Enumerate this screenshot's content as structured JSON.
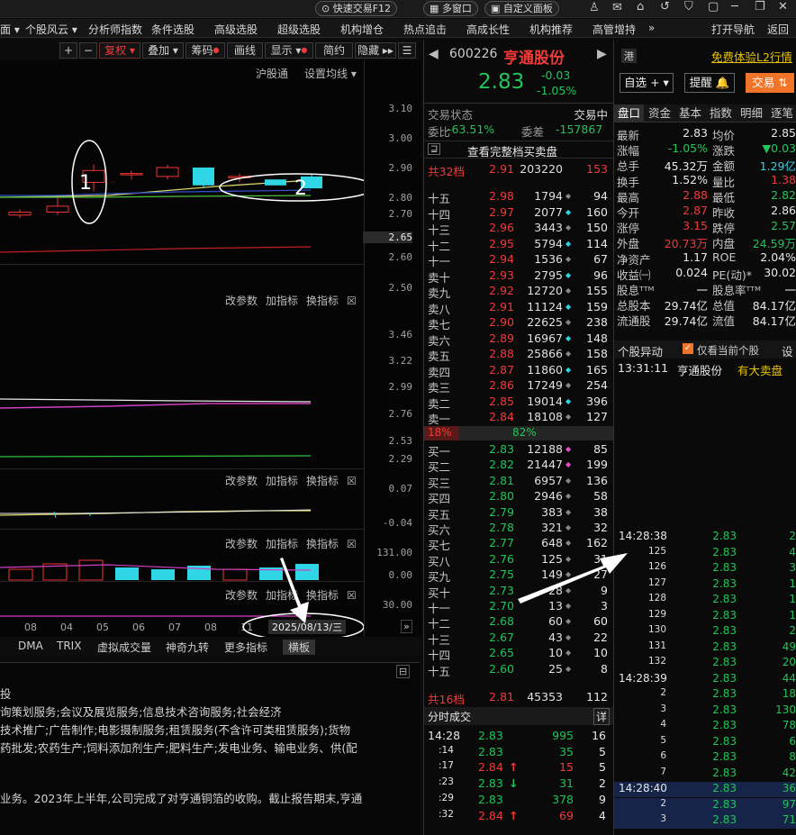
{
  "topbar": {
    "quick_trade": "快速交易F12",
    "multi_window": "多窗口",
    "custom_panel": "自定义面板"
  },
  "menu": [
    "面 ▾",
    "个股风云 ▾",
    "分析师指数",
    "条件选股",
    "高级选股",
    "超级选股",
    "机构增仓",
    "热点追击",
    "高成长性",
    "机构推荐",
    "高管增持",
    "»",
    "打开导航",
    "返回"
  ],
  "chart_toolbar": {
    "plus": "+",
    "minus": "−",
    "fuquan": "复权 ▾",
    "diejia": "叠加 ▾",
    "chouma": "筹码",
    "huaxian": "画线",
    "xianshi": "显示 ▾",
    "jianyue": "简约",
    "yincang": "隐藏 ▸▸"
  },
  "chart": {
    "hgt": "沪股通",
    "ma_setting": "设置均线 ▾",
    "price_axis": [
      "3.10",
      "3.00",
      "2.90",
      "2.80",
      "2.70",
      "2.65",
      "2.60",
      "2.50"
    ],
    "ind1_axis": [
      "3.46",
      "3.22",
      "2.99",
      "2.76",
      "2.53",
      "2.29"
    ],
    "ind2_axis": [
      "0.07",
      "-0.04"
    ],
    "ind3_axis": [
      "131.00",
      "0.00"
    ],
    "ind4_axis": [
      "30.00"
    ],
    "panel_actions": [
      "改参数",
      "加指标",
      "换指标",
      "☒"
    ],
    "x_labels": [
      "08",
      "04",
      "05",
      "06",
      "07",
      "08",
      "11"
    ],
    "date_label": "2025/08/13/三",
    "annotations": [
      "1",
      "2"
    ]
  },
  "chart_data": {
    "type": "candlestick",
    "x": [
      "08",
      "04",
      "05",
      "06",
      "07",
      "08",
      "11",
      "2025/08/13"
    ],
    "ohlc": [
      [
        2.74,
        2.76,
        2.73,
        2.75
      ],
      [
        2.75,
        2.8,
        2.74,
        2.77
      ],
      [
        2.85,
        2.91,
        2.82,
        2.89
      ],
      [
        2.88,
        2.89,
        2.86,
        2.88
      ],
      [
        2.87,
        2.91,
        2.86,
        2.9
      ],
      [
        2.9,
        2.9,
        2.83,
        2.84
      ],
      [
        2.87,
        2.88,
        2.85,
        2.87
      ],
      [
        2.86,
        2.86,
        2.84,
        2.84
      ],
      [
        2.87,
        2.88,
        2.83,
        2.83
      ]
    ]
  },
  "bottom_tabs": [
    "DMA",
    "TRIX",
    "虚拟成交量",
    "神奇九转",
    "更多指标",
    "横板"
  ],
  "info": {
    "title": "投",
    "lines": [
      "询策划服务;会议及展览服务;信息技术咨询服务;社会经济",
      "技术推广;广告制作;电影摄制服务;租赁服务(不含许可类租赁服务);货物",
      "药批发;农药生产;饲料添加剂生产;肥料生产;发电业务、输电业务、供(配",
      "业务。2023年上半年,公司完成了对亨通铜箔的收购。截止报告期末,亨通"
    ]
  },
  "quote": {
    "code": "600226",
    "name": "亨通股份",
    "price": "2.83",
    "change": "-0.03",
    "pct": "-1.05%",
    "status_label": "交易状态",
    "status": "交易中",
    "weibi_label": "委比",
    "weibi": "-63.51%",
    "weicha_label": "委差",
    "weicha": "-157867",
    "full_book": "查看完整档买卖盘",
    "ask_total_label": "共32档",
    "ask_total_price": "2.91",
    "ask_total_vol": "203220",
    "ask_total_n": "153",
    "ratio_left": "18%",
    "ratio_right": "82%",
    "bid_total_label": "共16档",
    "bid_total_price": "2.81",
    "bid_total_vol": "45353",
    "bid_total_n": "112"
  },
  "asks": [
    [
      "十五",
      "2.98",
      "1794",
      "94"
    ],
    [
      "十四",
      "2.97",
      "2077",
      "160"
    ],
    [
      "十三",
      "2.96",
      "3443",
      "150"
    ],
    [
      "十二",
      "2.95",
      "5794",
      "114"
    ],
    [
      "十一",
      "2.94",
      "1536",
      "67"
    ],
    [
      "卖十",
      "2.93",
      "2795",
      "96"
    ],
    [
      "卖九",
      "2.92",
      "12720",
      "155"
    ],
    [
      "卖八",
      "2.91",
      "11124",
      "159"
    ],
    [
      "卖七",
      "2.90",
      "22625",
      "238"
    ],
    [
      "卖六",
      "2.89",
      "16967",
      "148"
    ],
    [
      "卖五",
      "2.88",
      "25866",
      "158"
    ],
    [
      "卖四",
      "2.87",
      "11860",
      "165"
    ],
    [
      "卖三",
      "2.86",
      "17249",
      "254"
    ],
    [
      "卖二",
      "2.85",
      "19014",
      "396"
    ],
    [
      "卖一",
      "2.84",
      "18108",
      "127"
    ]
  ],
  "bids": [
    [
      "买一",
      "2.83",
      "12188",
      "85"
    ],
    [
      "买二",
      "2.82",
      "21447",
      "199"
    ],
    [
      "买三",
      "2.81",
      "6957",
      "136"
    ],
    [
      "买四",
      "2.80",
      "2946",
      "58"
    ],
    [
      "买五",
      "2.79",
      "383",
      "38"
    ],
    [
      "买六",
      "2.78",
      "321",
      "32"
    ],
    [
      "买七",
      "2.77",
      "648",
      "162"
    ],
    [
      "买八",
      "2.76",
      "125",
      "31"
    ],
    [
      "买九",
      "2.75",
      "149",
      "27"
    ],
    [
      "买十",
      "2.73",
      "28",
      "9"
    ],
    [
      "十一",
      "2.70",
      "13",
      "3"
    ],
    [
      "十二",
      "2.68",
      "60",
      "60"
    ],
    [
      "十三",
      "2.67",
      "43",
      "22"
    ],
    [
      "十四",
      "2.65",
      "10",
      "10"
    ],
    [
      "十五",
      "2.60",
      "25",
      "8"
    ]
  ],
  "fenshi": {
    "title": "分时成交",
    "detail": "详",
    "rows": [
      [
        "14:28",
        "2.83",
        "995",
        "16",
        ""
      ],
      [
        ":14",
        "2.83",
        "35",
        "5",
        ""
      ],
      [
        ":17",
        "2.84",
        "15",
        "5",
        "up"
      ],
      [
        ":23",
        "2.83",
        "31",
        "2",
        "down"
      ],
      [
        ":29",
        "2.83",
        "378",
        "9",
        ""
      ],
      [
        ":32",
        "2.84",
        "69",
        "4",
        "up"
      ]
    ]
  },
  "right": {
    "hk": "港",
    "free_l2": "免费体验L2行情",
    "zixuan": "自选 + ▾",
    "tixing": "提醒 🔔",
    "jiaoyi": "交易 ⇅",
    "tabs": [
      "盘口",
      "资金",
      "基本",
      "指数",
      "明细",
      "逐笔"
    ],
    "stats": [
      [
        "最新",
        "2.83",
        "均价",
        "2.85"
      ],
      [
        "涨幅",
        "-1.05%",
        "涨跌",
        "▼0.03"
      ],
      [
        "总手",
        "45.32万",
        "金额",
        "1.29亿"
      ],
      [
        "换手",
        "1.52%",
        "量比",
        "1.38"
      ],
      [
        "最高",
        "2.88",
        "最低",
        "2.82"
      ],
      [
        "今开",
        "2.87",
        "昨收",
        "2.86"
      ],
      [
        "涨停",
        "3.15",
        "跌停",
        "2.57"
      ],
      [
        "外盘",
        "20.73万",
        "内盘",
        "24.59万"
      ],
      [
        "净资产",
        "1.17",
        "ROE",
        "2.04%"
      ],
      [
        "收益㈠",
        "0.024",
        "PE(动)*",
        "30.02"
      ],
      [
        "股息ᵀᵀᴹ",
        "一",
        "股息率ᵀᵀᴹ",
        "一"
      ],
      [
        "总股本",
        "29.74亿",
        "总值",
        "84.17亿"
      ],
      [
        "流通股",
        "29.74亿",
        "流值",
        "84.17亿"
      ]
    ],
    "yidong_label": "个股异动",
    "only_current": "仅看当前个股",
    "setting": "设",
    "yidong_time": "13:31:11",
    "yidong_name": "亨通股份",
    "yidong_event": "有大卖盘",
    "ticks": [
      [
        "14:28:38",
        "",
        "2.83",
        "2"
      ],
      [
        "",
        "125",
        "2.83",
        "4"
      ],
      [
        "",
        "126",
        "2.83",
        "3"
      ],
      [
        "",
        "127",
        "2.83",
        "1"
      ],
      [
        "",
        "128",
        "2.83",
        "1"
      ],
      [
        "",
        "129",
        "2.83",
        "1"
      ],
      [
        "",
        "130",
        "2.83",
        "2"
      ],
      [
        "",
        "131",
        "2.83",
        "49"
      ],
      [
        "",
        "132",
        "2.83",
        "20"
      ],
      [
        "14:28:39",
        "",
        "2.83",
        "44"
      ],
      [
        "",
        "2",
        "2.83",
        "18"
      ],
      [
        "",
        "3",
        "2.83",
        "130"
      ],
      [
        "",
        "4",
        "2.83",
        "78"
      ],
      [
        "",
        "5",
        "2.83",
        "6"
      ],
      [
        "",
        "6",
        "2.83",
        "8"
      ],
      [
        "",
        "7",
        "2.83",
        "42"
      ],
      [
        "14:28:40",
        "",
        "2.83",
        "36"
      ],
      [
        "",
        "2",
        "2.83",
        "97"
      ],
      [
        "",
        "3",
        "2.83",
        "71"
      ]
    ]
  },
  "colors": {
    "red": "#f23a3a",
    "green": "#21c45a",
    "cyan": "#2ed6e6",
    "yellow": "#e5c100",
    "orange": "#f0742a"
  }
}
